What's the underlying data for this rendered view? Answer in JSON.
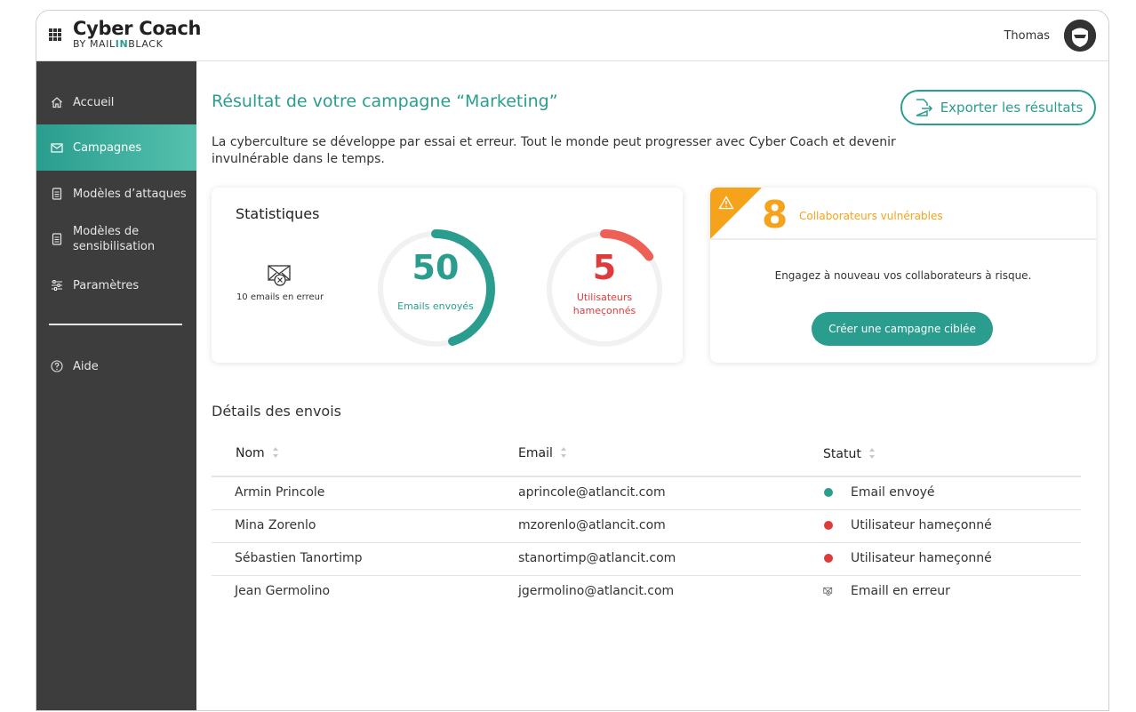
{
  "app": {
    "brand_title": "Cyber Coach",
    "brand_sub_prefix": "BY MAIL",
    "brand_sub_highlight": "IN",
    "brand_sub_suffix": "BLACK",
    "user_name": "Thomas"
  },
  "sidebar": {
    "items": [
      {
        "label": "Accueil",
        "icon": "home-icon"
      },
      {
        "label": "Campagnes",
        "icon": "mail-icon",
        "active": true
      },
      {
        "label": "Modèles d’attaques",
        "icon": "document-icon"
      },
      {
        "label": "Modèles de sensibilisation",
        "icon": "document-icon"
      },
      {
        "label": "Paramètres",
        "icon": "sliders-icon"
      },
      {
        "label": "Aide",
        "icon": "help-icon"
      }
    ]
  },
  "main": {
    "title": "Résultat de votre campagne “Marketing”",
    "export_label": "Exporter les résultats",
    "intro": "La cyberculture se développe par essai et erreur. Tout le monde peut progresser avec Cyber Coach et devenir invulnérable dans le temps."
  },
  "stats": {
    "title": "Statistiques",
    "error_text": "10 emails en erreur",
    "sent_value": "50",
    "sent_label": "Emails envoyés",
    "sent_fraction": 0.45,
    "phished_value": "5",
    "phished_label_1": "Utilisateurs",
    "phished_label_2": "hameçonnés",
    "phished_fraction": 0.15
  },
  "vulnerable": {
    "count": "8",
    "label": "Collaborateurs vulnérables",
    "text": "Engagez à nouveau vos collaborateurs à risque.",
    "button": "Créer une campagne ciblée"
  },
  "details": {
    "title": "Détails des envois",
    "columns": [
      "Nom",
      "Email",
      "Statut"
    ],
    "rows": [
      {
        "name": "Armin Princole",
        "email": "aprincole@atlancit.com",
        "status": "Email envoyé",
        "status_type": "sent"
      },
      {
        "name": "Mina Zorenlo",
        "email": "mzorenlo@atlancit.com",
        "status": "Utilisateur hameçonné",
        "status_type": "phished"
      },
      {
        "name": "Sébastien Tanortimp",
        "email": "stanortimp@atlancit.com",
        "status": "Utilisateur hameçonné",
        "status_type": "phished"
      },
      {
        "name": "Jean Germolino",
        "email": "jgermolino@atlancit.com",
        "status": "Emaill en erreur",
        "status_type": "error"
      }
    ]
  },
  "colors": {
    "accent": "#2a9d8f",
    "warning": "#f7a21b",
    "danger": "#e03b3b",
    "gauge_red": "#ee6055",
    "sidebar_bg": "#3d3d3d"
  }
}
